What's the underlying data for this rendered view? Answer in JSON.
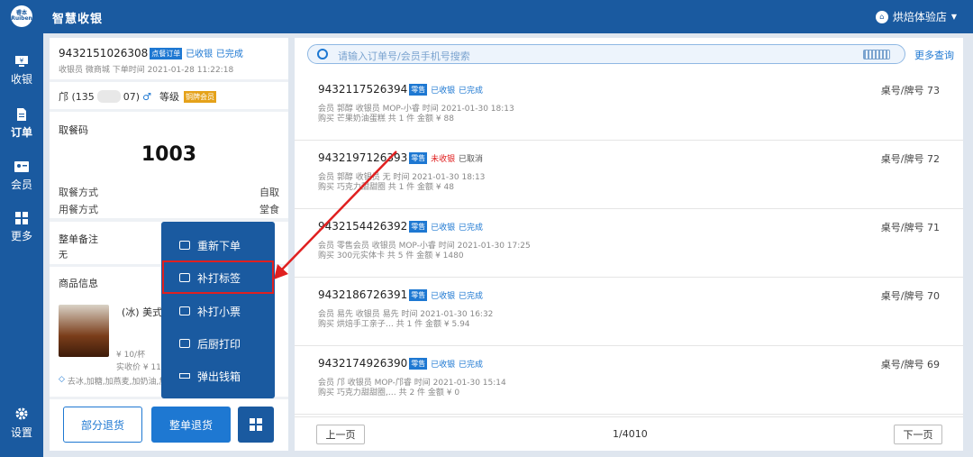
{
  "app": {
    "logo": "睿本 Ruiben",
    "title": "智慧收银",
    "store": "烘焙体验店"
  },
  "nav": [
    {
      "label": "收银",
      "icon": "cashier-icon"
    },
    {
      "label": "订单",
      "icon": "order-icon"
    },
    {
      "label": "会员",
      "icon": "member-icon"
    },
    {
      "label": "更多",
      "icon": "more-grid-icon"
    },
    {
      "label": "设置",
      "icon": "gear-icon"
    }
  ],
  "detail": {
    "order_no": "9432151026308",
    "type_badge": "点餐订单",
    "pay_status": "已收银",
    "status": "已完成",
    "cashier_line": "收银员 微商城 下单时间 2021-01-28 11:22:18",
    "member_name": "邝 (135",
    "member_tail": "07)",
    "gender": "♂",
    "level_label": "等级",
    "level_badge": "铜牌会员",
    "pickup_label": "取餐码",
    "pickup_code": "1003",
    "take_method_label": "取餐方式",
    "take_method_value": "自取",
    "dine_method_label": "用餐方式",
    "dine_method_value": "堂食",
    "remark_label": "整单备注",
    "remark_value": "无",
    "goods_label": "商品信息",
    "goods_name": "(冰) 美式",
    "goods_price": "¥ 10/杯",
    "goods_paid": "实收价 ¥ 11/杯",
    "goods_tags": "去冰,加糖,加燕麦,加奶油,加",
    "btn_partial_refund": "部分退货",
    "btn_full_refund": "整单退货"
  },
  "popup": [
    {
      "label": "重新下单",
      "icon": "reorder-icon"
    },
    {
      "label": "补打标签",
      "icon": "print-label-icon"
    },
    {
      "label": "补打小票",
      "icon": "print-receipt-icon"
    },
    {
      "label": "后厨打印",
      "icon": "kitchen-print-icon"
    },
    {
      "label": "弹出钱箱",
      "icon": "cash-drawer-icon"
    }
  ],
  "search": {
    "placeholder": "请输入订单号/会员手机号搜索",
    "more": "更多查询"
  },
  "orders": [
    {
      "no": "9432117526394",
      "badge": "零售",
      "pay": "已收银",
      "pay_red": false,
      "status": "已完成",
      "l1": "会员 郭醇  收银员 MOP-小睿  时间 2021-01-30 18:13",
      "l2": "购买 芒果奶油蛋糕  共 1 件  金额 ¥ 88",
      "table": "桌号/牌号 73"
    },
    {
      "no": "9432197126393",
      "badge": "零售",
      "pay": "未收银",
      "pay_red": true,
      "status": "已取消",
      "l1": "会员 郭醇  收银员 无  时间 2021-01-30 18:13",
      "l2": "购买 巧克力甜甜圈  共 1 件  金额 ¥ 48",
      "table": "桌号/牌号 72"
    },
    {
      "no": "9432154426392",
      "badge": "零售",
      "pay": "已收银",
      "pay_red": false,
      "status": "已完成",
      "l1": "会员 零售会员  收银员 MOP-小睿  时间 2021-01-30 17:25",
      "l2": "购买 300元实体卡  共 5 件  金额 ¥ 1480",
      "table": "桌号/牌号 71"
    },
    {
      "no": "9432186726391",
      "badge": "零售",
      "pay": "已收银",
      "pay_red": false,
      "status": "已完成",
      "l1": "会员 易先  收银员 易先  时间 2021-01-30 16:32",
      "l2": "购买 烘焙手工亲子…  共 1 件  金额 ¥ 5.94",
      "table": "桌号/牌号 70"
    },
    {
      "no": "9432174926390",
      "badge": "零售",
      "pay": "已收银",
      "pay_red": false,
      "status": "已完成",
      "l1": "会员 邝  收银员 MOP-邝睿  时间 2021-01-30 15:14",
      "l2": "购买 巧克力甜甜圈,…  共 2 件  金额 ¥ 0",
      "table": "桌号/牌号 69"
    }
  ],
  "pager": {
    "prev": "上一页",
    "info": "1/4010",
    "next": "下一页"
  }
}
